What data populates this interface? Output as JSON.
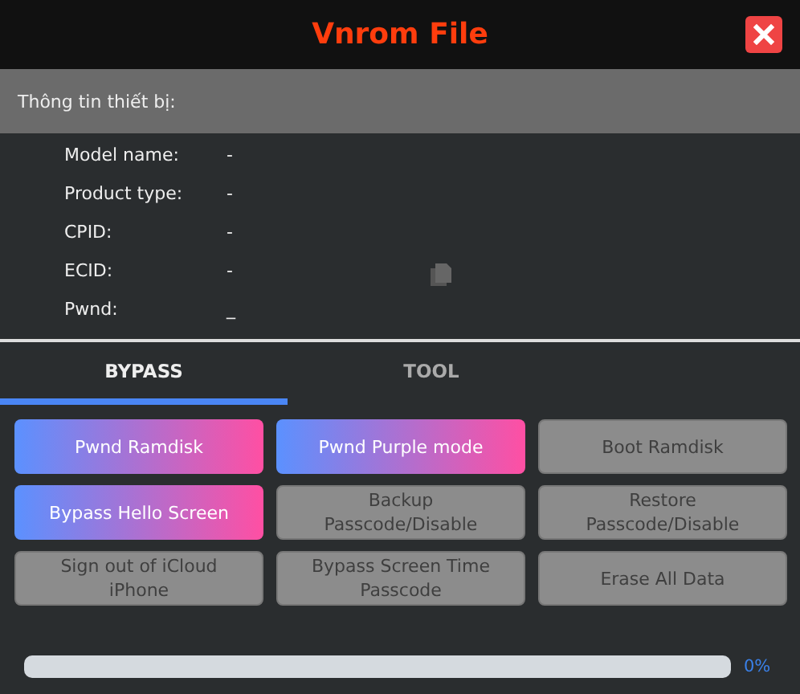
{
  "window": {
    "title": "Vnrom File"
  },
  "device_info": {
    "header": "Thông tin thiết bị:",
    "fields": [
      {
        "label": "Model name:",
        "value": "-"
      },
      {
        "label": "Product type:",
        "value": "-"
      },
      {
        "label": "CPID:",
        "value": "-"
      },
      {
        "label": "ECID:",
        "value": "-"
      },
      {
        "label": "Pwnd:",
        "value": "_"
      }
    ]
  },
  "tabs": [
    {
      "label": "BYPASS",
      "selected": true
    },
    {
      "label": "TOOL",
      "selected": false
    }
  ],
  "buttons": [
    {
      "label": "Pwnd Ramdisk",
      "disabled": false
    },
    {
      "label": "Pwnd Purple mode",
      "disabled": false
    },
    {
      "label": "Boot Ramdisk",
      "disabled": true
    },
    {
      "label": "Bypass Hello Screen",
      "disabled": false
    },
    {
      "label": "Backup Passcode/Disable",
      "disabled": true
    },
    {
      "label": "Restore Passcode/Disable",
      "disabled": true
    },
    {
      "label": "Sign out of iCloud iPhone",
      "disabled": true
    },
    {
      "label": "Bypass Screen Time Passcode",
      "disabled": true
    },
    {
      "label": "Erase All Data",
      "disabled": true
    }
  ],
  "progress": {
    "level": 0,
    "reading": "0%"
  }
}
